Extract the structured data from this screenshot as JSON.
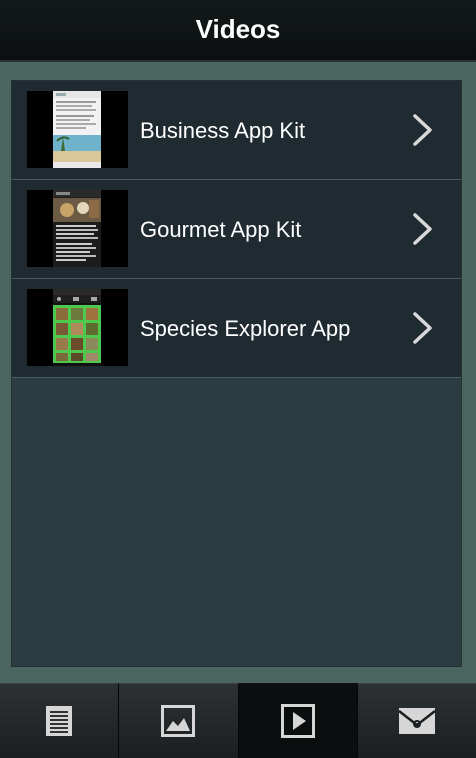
{
  "header": {
    "title": "Videos"
  },
  "list": {
    "items": [
      {
        "label": "Business App Kit",
        "thumb_icon": "business-app-screenshot"
      },
      {
        "label": "Gourmet App Kit",
        "thumb_icon": "gourmet-app-screenshot"
      },
      {
        "label": "Species Explorer App",
        "thumb_icon": "species-explorer-screenshot"
      }
    ]
  },
  "tabbar": {
    "tabs": [
      {
        "icon": "document-icon",
        "active": false
      },
      {
        "icon": "photo-icon",
        "active": false
      },
      {
        "icon": "play-icon",
        "active": true
      },
      {
        "icon": "envelope-icon",
        "active": false
      }
    ]
  },
  "colors": {
    "background": "#4b6661",
    "header": "#0b0f10",
    "panel": "#2c3d42",
    "row": "#1f2b31",
    "text": "#ffffff"
  }
}
